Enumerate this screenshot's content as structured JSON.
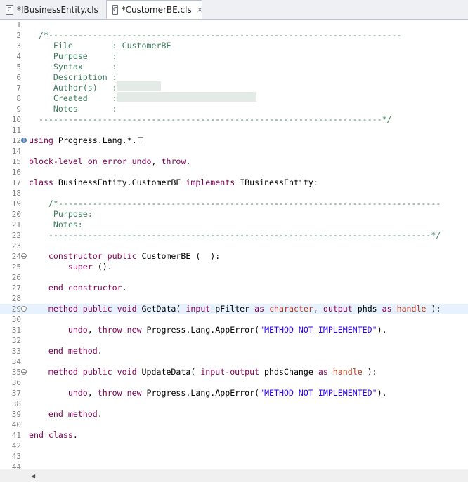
{
  "tabs": [
    {
      "label": "*IBusinessEntity.cls",
      "icon": "C",
      "active": false
    },
    {
      "label": "*CustomerBE.cls",
      "icon": "C",
      "active": true,
      "close": "×"
    }
  ],
  "lines": [
    {
      "n": "1"
    },
    {
      "n": "2",
      "segs": [
        {
          "t": "  /*------------------------------------------------------------------------",
          "c": "cm"
        }
      ]
    },
    {
      "n": "3",
      "segs": [
        {
          "t": "     File        : CustomerBE",
          "c": "cm"
        }
      ]
    },
    {
      "n": "4",
      "segs": [
        {
          "t": "     Purpose     :",
          "c": "cm"
        }
      ]
    },
    {
      "n": "5",
      "segs": [
        {
          "t": "     Syntax      :",
          "c": "cm"
        }
      ]
    },
    {
      "n": "6",
      "segs": [
        {
          "t": "     Description :",
          "c": "cm"
        }
      ]
    },
    {
      "n": "7",
      "segs": [
        {
          "t": "     Author(s)   :",
          "c": "cm"
        }
      ]
    },
    {
      "n": "8",
      "segs": [
        {
          "t": "     Created     :",
          "c": "cm"
        }
      ]
    },
    {
      "n": "9",
      "segs": [
        {
          "t": "     Notes       :",
          "c": "cm"
        }
      ]
    },
    {
      "n": "10",
      "segs": [
        {
          "t": "  ----------------------------------------------------------------------*/",
          "c": "cm"
        }
      ]
    },
    {
      "n": "11"
    },
    {
      "n": "12",
      "fold": "+",
      "box": true,
      "segs": [
        {
          "t": "using",
          "c": "kw"
        },
        {
          "t": " Progress.Lang.*."
        }
      ]
    },
    {
      "n": "14"
    },
    {
      "n": "15",
      "segs": [
        {
          "t": "block-level on error undo",
          "c": "kw"
        },
        {
          "t": ", "
        },
        {
          "t": "throw",
          "c": "kw"
        },
        {
          "t": "."
        }
      ]
    },
    {
      "n": "16"
    },
    {
      "n": "17",
      "segs": [
        {
          "t": "class",
          "c": "kw"
        },
        {
          "t": " BusinessEntity.CustomerBE "
        },
        {
          "t": "implements",
          "c": "kw"
        },
        {
          "t": " IBusinessEntity:"
        }
      ]
    },
    {
      "n": "18"
    },
    {
      "n": "19",
      "segs": [
        {
          "t": "    /*------------------------------------------------------------------------------",
          "c": "cm"
        }
      ]
    },
    {
      "n": "20",
      "segs": [
        {
          "t": "     Purpose:",
          "c": "cm"
        }
      ]
    },
    {
      "n": "21",
      "segs": [
        {
          "t": "     Notes:",
          "c": "cm"
        }
      ]
    },
    {
      "n": "22",
      "segs": [
        {
          "t": "    ------------------------------------------------------------------------------*/",
          "c": "cm"
        }
      ]
    },
    {
      "n": "23"
    },
    {
      "n": "24",
      "fold": "-",
      "segs": [
        {
          "t": "    "
        },
        {
          "t": "constructor public",
          "c": "kw"
        },
        {
          "t": " CustomerBE (  ):"
        }
      ]
    },
    {
      "n": "25",
      "segs": [
        {
          "t": "        "
        },
        {
          "t": "super",
          "c": "kw"
        },
        {
          "t": " ()."
        }
      ]
    },
    {
      "n": "26"
    },
    {
      "n": "27",
      "segs": [
        {
          "t": "    "
        },
        {
          "t": "end constructor",
          "c": "kw"
        },
        {
          "t": "."
        }
      ]
    },
    {
      "n": "28"
    },
    {
      "n": "29",
      "fold": "-",
      "hl": true,
      "segs": [
        {
          "t": "    "
        },
        {
          "t": "method public void",
          "c": "kw"
        },
        {
          "t": " GetData( "
        },
        {
          "t": "input",
          "c": "kw"
        },
        {
          "t": " pFilter "
        },
        {
          "t": "as",
          "c": "kw"
        },
        {
          "t": " "
        },
        {
          "t": "character",
          "c": "ty"
        },
        {
          "t": ", "
        },
        {
          "t": "output",
          "c": "kw"
        },
        {
          "t": " phds "
        },
        {
          "t": "as",
          "c": "kw"
        },
        {
          "t": " "
        },
        {
          "t": "handle",
          "c": "ty"
        },
        {
          "t": " ):"
        }
      ]
    },
    {
      "n": "30"
    },
    {
      "n": "31",
      "segs": [
        {
          "t": "        "
        },
        {
          "t": "undo",
          "c": "kw"
        },
        {
          "t": ", "
        },
        {
          "t": "throw new",
          "c": "kw"
        },
        {
          "t": " Progress.Lang.AppError("
        },
        {
          "t": "\"METHOD NOT IMPLEMENTED\"",
          "c": "st"
        },
        {
          "t": ")."
        }
      ]
    },
    {
      "n": "32"
    },
    {
      "n": "33",
      "segs": [
        {
          "t": "    "
        },
        {
          "t": "end method",
          "c": "kw"
        },
        {
          "t": "."
        }
      ]
    },
    {
      "n": "34"
    },
    {
      "n": "35",
      "fold": "-",
      "segs": [
        {
          "t": "    "
        },
        {
          "t": "method public void",
          "c": "kw"
        },
        {
          "t": " UpdateData( "
        },
        {
          "t": "input-output",
          "c": "kw"
        },
        {
          "t": " phdsChange "
        },
        {
          "t": "as",
          "c": "kw"
        },
        {
          "t": " "
        },
        {
          "t": "handle",
          "c": "ty"
        },
        {
          "t": " ):"
        }
      ]
    },
    {
      "n": "36"
    },
    {
      "n": "37",
      "segs": [
        {
          "t": "        "
        },
        {
          "t": "undo",
          "c": "kw"
        },
        {
          "t": ", "
        },
        {
          "t": "throw new",
          "c": "kw"
        },
        {
          "t": " Progress.Lang.AppError("
        },
        {
          "t": "\"METHOD NOT IMPLEMENTED\"",
          "c": "st"
        },
        {
          "t": ")."
        }
      ]
    },
    {
      "n": "38"
    },
    {
      "n": "39",
      "segs": [
        {
          "t": "    "
        },
        {
          "t": "end method",
          "c": "kw"
        },
        {
          "t": "."
        }
      ]
    },
    {
      "n": "40"
    },
    {
      "n": "41",
      "segs": [
        {
          "t": "end class",
          "c": "kw"
        },
        {
          "t": "."
        }
      ]
    },
    {
      "n": "42"
    },
    {
      "n": "43"
    },
    {
      "n": "44"
    }
  ],
  "scrollbar": {
    "left_arrow": "◀"
  }
}
